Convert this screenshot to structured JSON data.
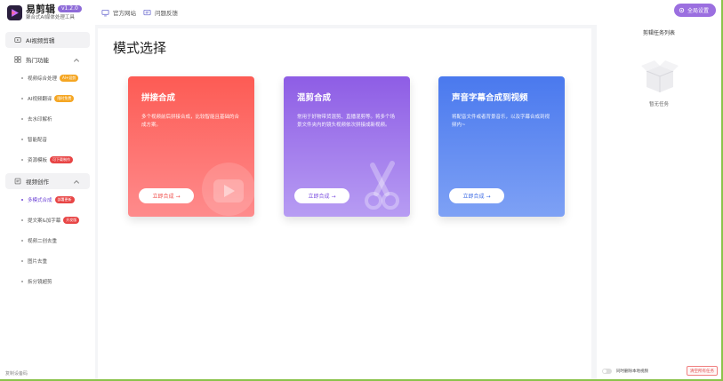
{
  "brand": {
    "name": "易剪辑",
    "version": "v1.2.0",
    "subtitle": "聚合式AI媒体处理工具"
  },
  "topbar": {
    "official_site": "官方网站",
    "feedback": "问题反馈",
    "settings": "全局设置"
  },
  "sidebar": {
    "main_item": "AI视频剪辑",
    "groups": [
      {
        "label": "热门功能",
        "items": [
          {
            "label": "视频综合处理",
            "badge": "AI+混剪",
            "badge_color": "#f5a623"
          },
          {
            "label": "AI视频翻译",
            "badge": "限时免费",
            "badge_color": "#f5a623"
          },
          {
            "label": "去水印解析",
            "badge": ""
          },
          {
            "label": "智能配音",
            "badge": ""
          },
          {
            "label": "资源模板",
            "badge": "可下载制作",
            "badge_color": "#e84545"
          }
        ]
      },
      {
        "label": "视频创作",
        "items": [
          {
            "label": "多模式合成",
            "badge": "部署更新",
            "badge_color": "#e84545",
            "active": true
          },
          {
            "label": "提文案&加字幕",
            "badge": "开发版",
            "badge_color": "#e84545"
          },
          {
            "label": "视频二创去重",
            "badge": ""
          },
          {
            "label": "图片去重",
            "badge": ""
          },
          {
            "label": "拆分镜超剪",
            "badge": ""
          }
        ]
      }
    ],
    "footer_note": "复制设备码"
  },
  "main": {
    "title": "模式选择",
    "cards": [
      {
        "title": "拼接合成",
        "desc": "多个视频前后拼接合成，比较智能且基础的合成方案。",
        "button": "立即合成 →"
      },
      {
        "title": "混剪合成",
        "desc": "常用于好物带货混剪、直播混剪等。将多个场景文件夹内的镜头视频依次拼接成新视频。",
        "button": "立即合成 →"
      },
      {
        "title": "声音字幕合成到视频",
        "desc": "将配音文件或者背景音乐，以及字幕合成到视频内~",
        "button": "立即合成 →"
      }
    ]
  },
  "right_panel": {
    "title": "剪辑任务列表",
    "empty_text": "暂无任务",
    "toggle_label": "同时删除本地视频",
    "clear_button": "清空所有任务"
  },
  "colors": {
    "accent": "#9b6fe0",
    "card1": "#fd5b54",
    "card2": "#8e5de5",
    "card3": "#4a79ee"
  }
}
